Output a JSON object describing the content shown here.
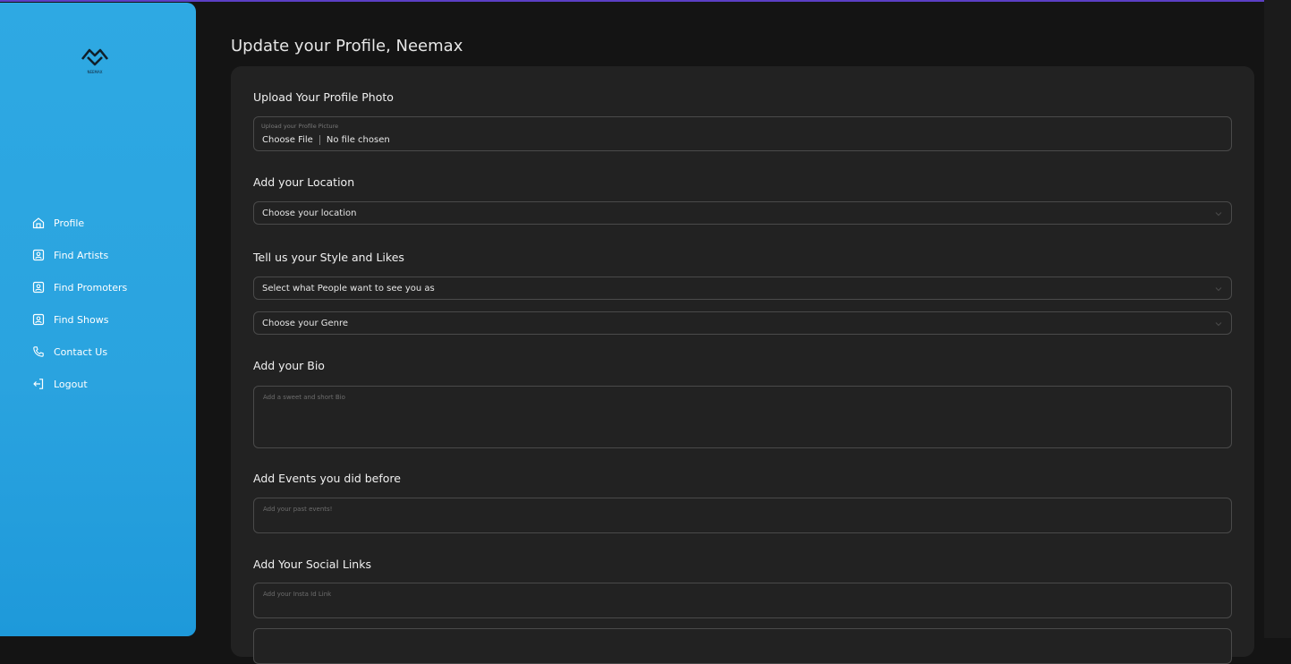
{
  "page": {
    "title": "Update your Profile, Neemax"
  },
  "brand": {
    "logo_text": "NEEMAX"
  },
  "sidebar": {
    "items": [
      {
        "label": "Profile",
        "icon": "home-icon"
      },
      {
        "label": "Find Artists",
        "icon": "contact-card-icon"
      },
      {
        "label": "Find Promoters",
        "icon": "contact-card-icon"
      },
      {
        "label": "Find Shows",
        "icon": "contact-card-icon"
      },
      {
        "label": "Contact Us",
        "icon": "phone-icon"
      },
      {
        "label": "Logout",
        "icon": "logout-icon"
      }
    ]
  },
  "form": {
    "photo": {
      "heading": "Upload Your Profile Photo",
      "label": "Upload your Profile Picture",
      "button": "Choose File",
      "status": "No file chosen"
    },
    "location": {
      "heading": "Add your Location",
      "placeholder": "Choose your location"
    },
    "style": {
      "heading": "Tell us your Style and Likes",
      "persona_placeholder": "Select what People want to see you as",
      "genre_placeholder": "Choose your Genre"
    },
    "bio": {
      "heading": "Add your Bio",
      "placeholder": "Add a sweet and short Bio"
    },
    "events": {
      "heading": "Add Events you did before",
      "placeholder": "Add your past events!"
    },
    "social": {
      "heading": "Add Your Social Links",
      "insta_placeholder": "Add your Insta Id Link"
    }
  },
  "colors": {
    "sidebar": "#2aa3df",
    "background": "#141414",
    "card": "#222222",
    "accent_top": "#5b3fc4"
  }
}
